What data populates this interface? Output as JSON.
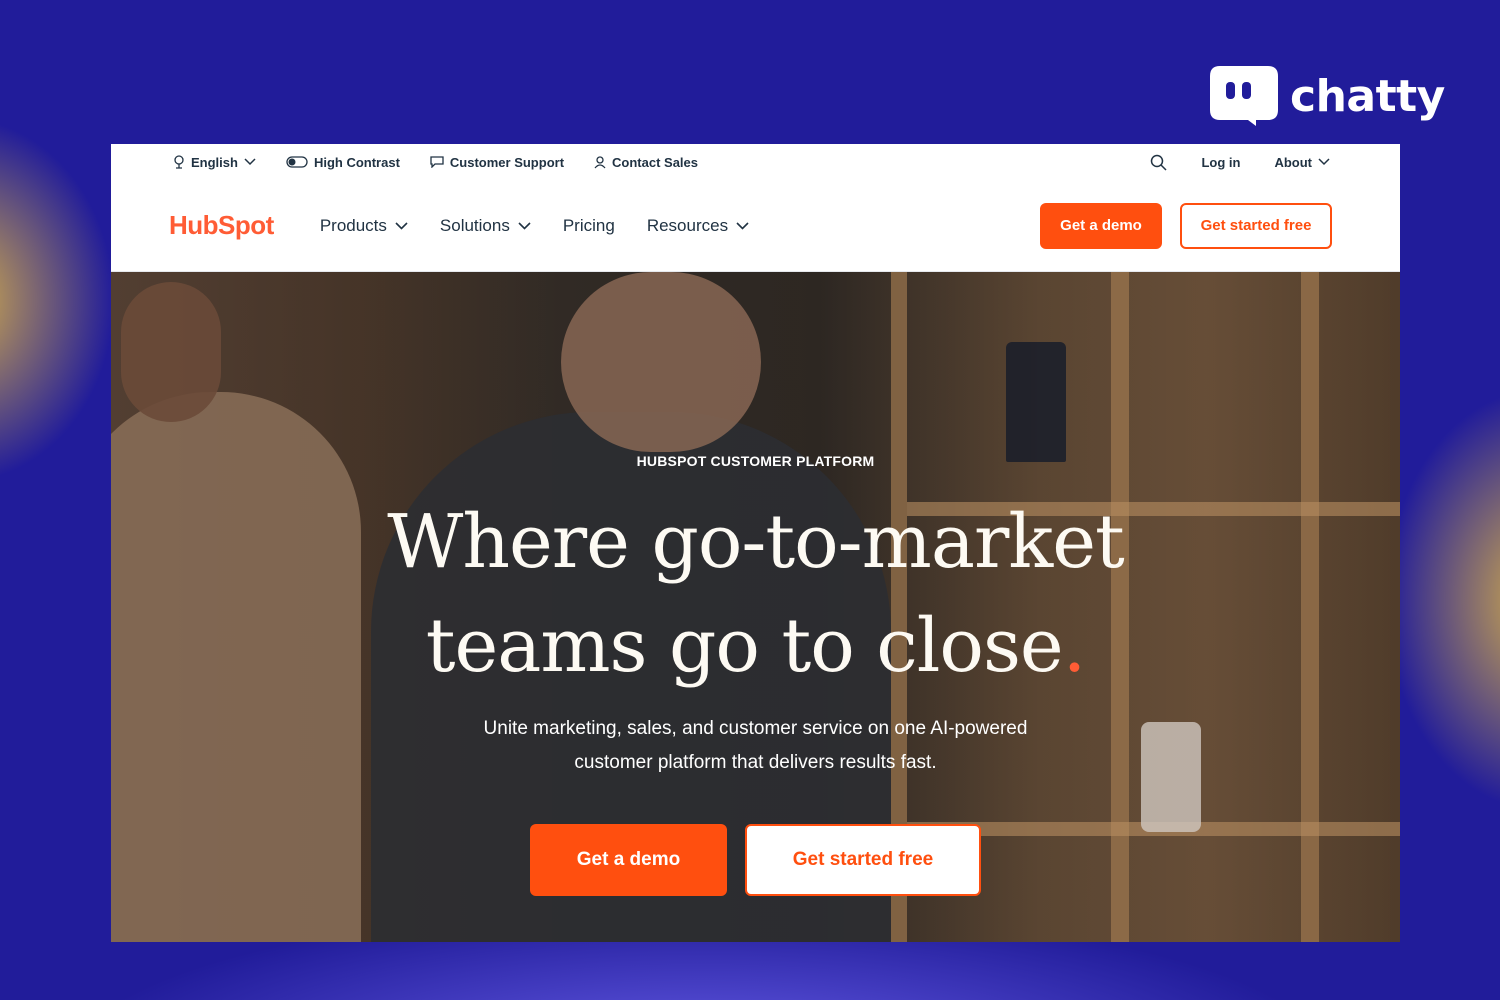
{
  "brand": {
    "name": "chatty",
    "icon": "chat-bubble-icon"
  },
  "utility_bar": {
    "language": "English",
    "high_contrast": "High Contrast",
    "customer_support": "Customer Support",
    "contact_sales": "Contact Sales",
    "log_in": "Log in",
    "about": "About"
  },
  "nav": {
    "logo": "HubSpot",
    "items": [
      "Products",
      "Solutions",
      "Pricing",
      "Resources"
    ],
    "get_demo": "Get a demo",
    "get_started": "Get started free"
  },
  "hero": {
    "eyebrow": "HUBSPOT CUSTOMER PLATFORM",
    "headline_line1": "Where go-to-market",
    "headline_line2": "teams go to close",
    "headline_dot": ".",
    "subtext_line1": "Unite marketing, sales, and customer service on one AI-powered",
    "subtext_line2": "customer platform that delivers results fast.",
    "cta_primary": "Get a demo",
    "cta_secondary": "Get started free"
  },
  "colors": {
    "background": "#211c9a",
    "accent": "#ff4f0f",
    "text_dark": "#213343"
  }
}
